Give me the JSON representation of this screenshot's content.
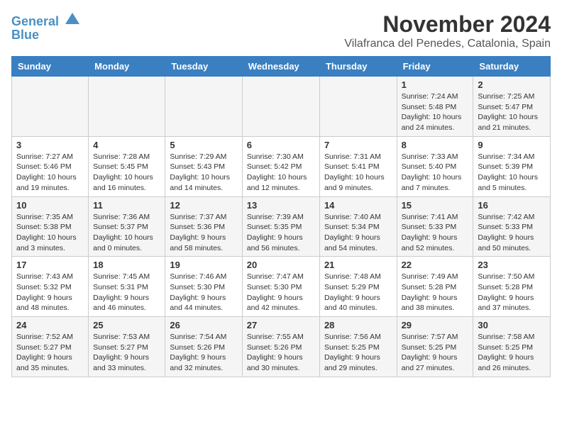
{
  "logo": {
    "line1": "General",
    "line2": "Blue"
  },
  "title": "November 2024",
  "location": "Vilafranca del Penedes, Catalonia, Spain",
  "headers": [
    "Sunday",
    "Monday",
    "Tuesday",
    "Wednesday",
    "Thursday",
    "Friday",
    "Saturday"
  ],
  "weeks": [
    [
      {
        "day": "",
        "info": ""
      },
      {
        "day": "",
        "info": ""
      },
      {
        "day": "",
        "info": ""
      },
      {
        "day": "",
        "info": ""
      },
      {
        "day": "",
        "info": ""
      },
      {
        "day": "1",
        "info": "Sunrise: 7:24 AM\nSunset: 5:48 PM\nDaylight: 10 hours and 24 minutes."
      },
      {
        "day": "2",
        "info": "Sunrise: 7:25 AM\nSunset: 5:47 PM\nDaylight: 10 hours and 21 minutes."
      }
    ],
    [
      {
        "day": "3",
        "info": "Sunrise: 7:27 AM\nSunset: 5:46 PM\nDaylight: 10 hours and 19 minutes."
      },
      {
        "day": "4",
        "info": "Sunrise: 7:28 AM\nSunset: 5:45 PM\nDaylight: 10 hours and 16 minutes."
      },
      {
        "day": "5",
        "info": "Sunrise: 7:29 AM\nSunset: 5:43 PM\nDaylight: 10 hours and 14 minutes."
      },
      {
        "day": "6",
        "info": "Sunrise: 7:30 AM\nSunset: 5:42 PM\nDaylight: 10 hours and 12 minutes."
      },
      {
        "day": "7",
        "info": "Sunrise: 7:31 AM\nSunset: 5:41 PM\nDaylight: 10 hours and 9 minutes."
      },
      {
        "day": "8",
        "info": "Sunrise: 7:33 AM\nSunset: 5:40 PM\nDaylight: 10 hours and 7 minutes."
      },
      {
        "day": "9",
        "info": "Sunrise: 7:34 AM\nSunset: 5:39 PM\nDaylight: 10 hours and 5 minutes."
      }
    ],
    [
      {
        "day": "10",
        "info": "Sunrise: 7:35 AM\nSunset: 5:38 PM\nDaylight: 10 hours and 3 minutes."
      },
      {
        "day": "11",
        "info": "Sunrise: 7:36 AM\nSunset: 5:37 PM\nDaylight: 10 hours and 0 minutes."
      },
      {
        "day": "12",
        "info": "Sunrise: 7:37 AM\nSunset: 5:36 PM\nDaylight: 9 hours and 58 minutes."
      },
      {
        "day": "13",
        "info": "Sunrise: 7:39 AM\nSunset: 5:35 PM\nDaylight: 9 hours and 56 minutes."
      },
      {
        "day": "14",
        "info": "Sunrise: 7:40 AM\nSunset: 5:34 PM\nDaylight: 9 hours and 54 minutes."
      },
      {
        "day": "15",
        "info": "Sunrise: 7:41 AM\nSunset: 5:33 PM\nDaylight: 9 hours and 52 minutes."
      },
      {
        "day": "16",
        "info": "Sunrise: 7:42 AM\nSunset: 5:33 PM\nDaylight: 9 hours and 50 minutes."
      }
    ],
    [
      {
        "day": "17",
        "info": "Sunrise: 7:43 AM\nSunset: 5:32 PM\nDaylight: 9 hours and 48 minutes."
      },
      {
        "day": "18",
        "info": "Sunrise: 7:45 AM\nSunset: 5:31 PM\nDaylight: 9 hours and 46 minutes."
      },
      {
        "day": "19",
        "info": "Sunrise: 7:46 AM\nSunset: 5:30 PM\nDaylight: 9 hours and 44 minutes."
      },
      {
        "day": "20",
        "info": "Sunrise: 7:47 AM\nSunset: 5:30 PM\nDaylight: 9 hours and 42 minutes."
      },
      {
        "day": "21",
        "info": "Sunrise: 7:48 AM\nSunset: 5:29 PM\nDaylight: 9 hours and 40 minutes."
      },
      {
        "day": "22",
        "info": "Sunrise: 7:49 AM\nSunset: 5:28 PM\nDaylight: 9 hours and 38 minutes."
      },
      {
        "day": "23",
        "info": "Sunrise: 7:50 AM\nSunset: 5:28 PM\nDaylight: 9 hours and 37 minutes."
      }
    ],
    [
      {
        "day": "24",
        "info": "Sunrise: 7:52 AM\nSunset: 5:27 PM\nDaylight: 9 hours and 35 minutes."
      },
      {
        "day": "25",
        "info": "Sunrise: 7:53 AM\nSunset: 5:27 PM\nDaylight: 9 hours and 33 minutes."
      },
      {
        "day": "26",
        "info": "Sunrise: 7:54 AM\nSunset: 5:26 PM\nDaylight: 9 hours and 32 minutes."
      },
      {
        "day": "27",
        "info": "Sunrise: 7:55 AM\nSunset: 5:26 PM\nDaylight: 9 hours and 30 minutes."
      },
      {
        "day": "28",
        "info": "Sunrise: 7:56 AM\nSunset: 5:25 PM\nDaylight: 9 hours and 29 minutes."
      },
      {
        "day": "29",
        "info": "Sunrise: 7:57 AM\nSunset: 5:25 PM\nDaylight: 9 hours and 27 minutes."
      },
      {
        "day": "30",
        "info": "Sunrise: 7:58 AM\nSunset: 5:25 PM\nDaylight: 9 hours and 26 minutes."
      }
    ]
  ]
}
